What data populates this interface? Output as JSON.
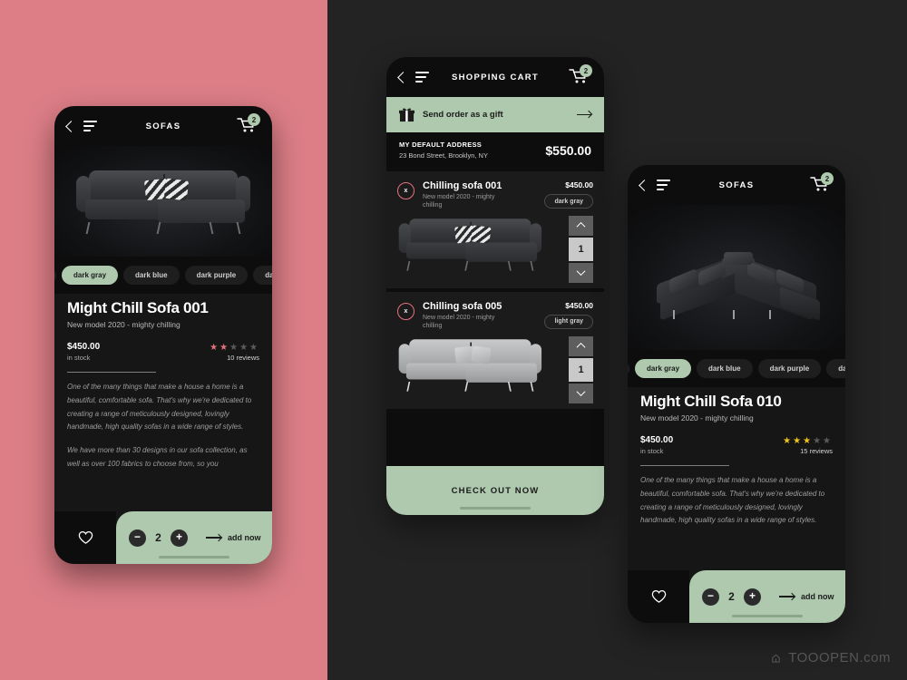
{
  "theme": {
    "pink_panel": "#dd7e87",
    "dark_bg": "#232323",
    "phone_bg": "#0d0d0d",
    "accent_green": "#aec9ae",
    "star_pink": "#e8717f",
    "star_gold": "#f0c419"
  },
  "phone1": {
    "topbar": {
      "title": "SOFAS",
      "cart_badge": "2",
      "back_icon": "chevron-left-icon",
      "menu_icon": "hamburger-icon",
      "cart_icon": "cart-icon"
    },
    "color_chips": [
      {
        "label": "dark gray",
        "selected": true
      },
      {
        "label": "dark blue",
        "selected": false
      },
      {
        "label": "dark purple",
        "selected": false
      },
      {
        "label": "dark",
        "selected": false
      }
    ],
    "product": {
      "title": "Might Chill Sofa 001",
      "subtitle": "New model 2020 - mighty chilling",
      "price": "$450.00",
      "stock": "in stock",
      "stars_filled": 2,
      "stars_total": 5,
      "star_color": "pink",
      "reviews": "10 reviews",
      "desc1": "One of the many things that make a house a home is a beautiful, comfortable sofa. That's why we're dedicated to creating a range of meticulously designed, lovingly handmade, high quality sofas in a wide range of styles.",
      "desc2": "We have more than 30 designs in our sofa collection, as well as over 100 fabrics to choose from, so you"
    },
    "addbar": {
      "fav_icon": "heart-icon",
      "minus": "−",
      "quantity": "2",
      "plus": "+",
      "add_label": "add now"
    }
  },
  "phone2": {
    "topbar": {
      "title": "SHOPPING CART",
      "cart_badge": "2",
      "back_icon": "chevron-left-icon",
      "menu_icon": "hamburger-icon",
      "cart_icon": "cart-icon"
    },
    "gift": {
      "icon": "gift-icon",
      "label": "Send order as a gift",
      "arrow": "arrow-right-icon"
    },
    "address": {
      "heading": "MY DEFAULT ADDRESS",
      "line": "23 Bond Street, Brooklyn, NY",
      "total": "$550.00"
    },
    "items": [
      {
        "remove": "x",
        "name": "Chilling sofa 001",
        "sub": "New model 2020 - mighty chilling",
        "price": "$450.00",
        "color_chip": "dark gray",
        "quantity": "1",
        "variant": "dark"
      },
      {
        "remove": "x",
        "name": "Chilling sofa 005",
        "sub": "New model 2020 - mighty chilling",
        "price": "$450.00",
        "color_chip": "light gray",
        "quantity": "1",
        "variant": "light"
      }
    ],
    "checkout_label": "CHECK OUT NOW"
  },
  "phone3": {
    "topbar": {
      "title": "SOFAS",
      "cart_badge": "2",
      "back_icon": "chevron-left-icon",
      "menu_icon": "hamburger-icon",
      "cart_icon": "cart-icon"
    },
    "color_chips": [
      {
        "label": "dark gray",
        "selected": true
      },
      {
        "label": "dark blue",
        "selected": false
      },
      {
        "label": "dark purple",
        "selected": false
      },
      {
        "label": "dark",
        "selected": false
      }
    ],
    "product": {
      "title": "Might Chill Sofa 010",
      "subtitle": "New model 2020 - mighty chilling",
      "price": "$450.00",
      "stock": "in stock",
      "stars_filled": 3,
      "stars_total": 5,
      "star_color": "gold",
      "reviews": "15 reviews",
      "desc1": "One of the many things that make a house a home is a beautiful, comfortable sofa. That's why we're dedicated to creating a range of meticulously designed, lovingly handmade, high quality sofas in a wide range of styles."
    },
    "addbar": {
      "fav_icon": "heart-icon",
      "minus": "−",
      "quantity": "2",
      "plus": "+",
      "add_label": "add now"
    }
  },
  "watermark": {
    "icon": "cloud-icon",
    "text": "TOOOPEN.com"
  }
}
